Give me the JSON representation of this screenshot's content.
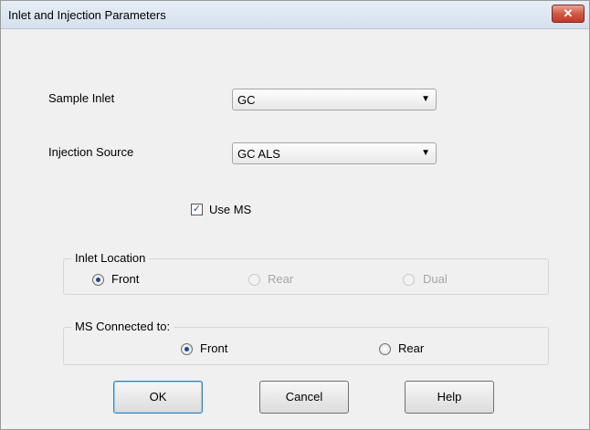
{
  "window": {
    "title": "Inlet and Injection Parameters",
    "close_glyph": "✕"
  },
  "sample_inlet": {
    "label": "Sample Inlet",
    "value": "GC"
  },
  "injection_source": {
    "label": "Injection Source",
    "value": "GC ALS"
  },
  "use_ms": {
    "label": "Use MS",
    "checked": true,
    "check_glyph": "✓"
  },
  "inlet_location": {
    "title": "Inlet Location",
    "options": [
      {
        "label": "Front",
        "selected": true,
        "enabled": true
      },
      {
        "label": "Rear",
        "selected": false,
        "enabled": false
      },
      {
        "label": "Dual",
        "selected": false,
        "enabled": false
      }
    ]
  },
  "ms_connected": {
    "title": "MS Connected to:",
    "options": [
      {
        "label": "Front",
        "selected": true
      },
      {
        "label": "Rear",
        "selected": false
      }
    ]
  },
  "buttons": {
    "ok": "OK",
    "cancel": "Cancel",
    "help": "Help"
  },
  "dropdown_arrow_glyph": "▼",
  "colors": {
    "accent": "#1c4b8c",
    "close": "#c0392b"
  }
}
